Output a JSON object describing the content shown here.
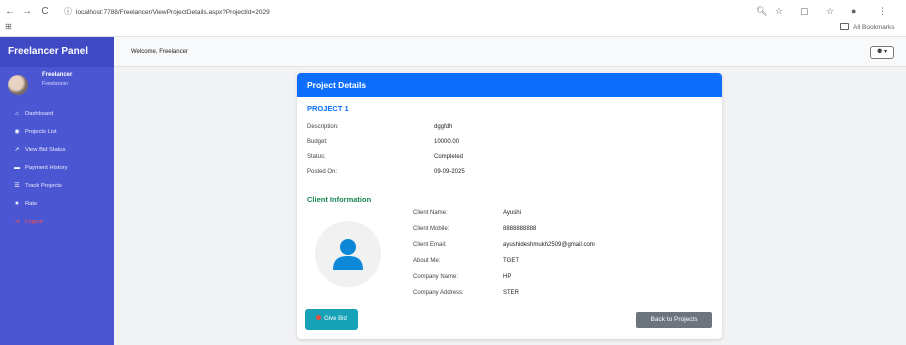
{
  "browser": {
    "back": "←",
    "forward": "→",
    "reload": "C",
    "url": "localhost:7788/Freelancer/ViewProjectDetails.aspx?ProjectId=2029",
    "bookmarks_label": "All Bookmarks"
  },
  "sidebar": {
    "title": "Freelancer Panel",
    "profile_name": "Freelancer",
    "profile_role": "Freelancer",
    "items": [
      {
        "label": "Dashboard",
        "icon": "home-icon",
        "glyph": "⌂"
      },
      {
        "label": "Projects List",
        "icon": "eye-icon",
        "glyph": "◉"
      },
      {
        "label": "View Bid Status",
        "icon": "gavel-icon",
        "glyph": "➚"
      },
      {
        "label": "Payment History",
        "icon": "wallet-icon",
        "glyph": "▬"
      },
      {
        "label": "Track Projects",
        "icon": "list-icon",
        "glyph": "☰"
      },
      {
        "label": "Rate",
        "icon": "star-icon",
        "glyph": "★"
      },
      {
        "label": "Logout",
        "icon": "logout-icon",
        "glyph": "⇥"
      }
    ]
  },
  "topbar": {
    "welcome": "Welcome, Freelancer",
    "user_menu": "⚉ ▾"
  },
  "card": {
    "header": "Project Details",
    "project_title": "PROJECT 1",
    "details": [
      {
        "label": "Description:",
        "value": "dggfdh"
      },
      {
        "label": "Budget:",
        "value": "10000.00"
      },
      {
        "label": "Status:",
        "value": "Completed"
      },
      {
        "label": "Posted On:",
        "value": "09-09-2025"
      }
    ],
    "client_title": "Client Information",
    "client": [
      {
        "label": "Client Name:",
        "value": "Ayushi"
      },
      {
        "label": "Client Mobile:",
        "value": "8888888888"
      },
      {
        "label": "Client Email:",
        "value": "ayushideshmukh2509@gmail.com"
      },
      {
        "label": "About Me:",
        "value": "TGET"
      },
      {
        "label": "Company Name:",
        "value": "HP"
      },
      {
        "label": "Company Address:",
        "value": "STER"
      }
    ],
    "give_bid": "Give Bid",
    "back": "Back to Projects"
  },
  "colors": {
    "sidebar": "#4b56d2",
    "header": "#0d6efd",
    "client_title": "#198754",
    "bid_button": "#17a2b8",
    "back_button": "#6c757d"
  }
}
